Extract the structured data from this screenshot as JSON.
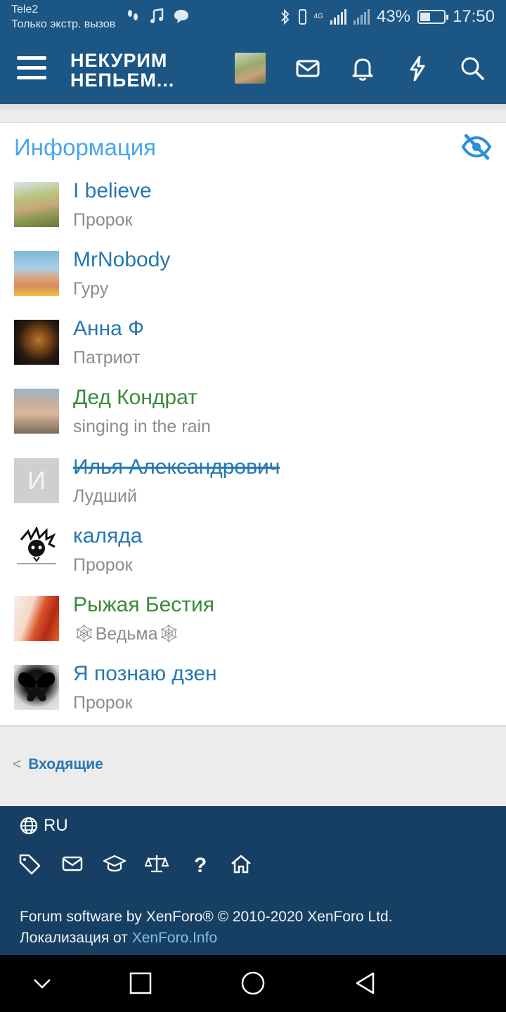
{
  "statusbar": {
    "carrier": "Tele2",
    "carrier_status": "Только экстр. вызов",
    "network": "4G",
    "battery": "43%",
    "battery_level": 0.43,
    "time": "17:50"
  },
  "header": {
    "logo_line1": "НЕКУРИМ",
    "logo_line2": "НЕПЬЕМ..."
  },
  "panel": {
    "title": "Информация",
    "members": [
      {
        "name": "I believe",
        "title": "Пророк",
        "style": "blue"
      },
      {
        "name": "MrNobody",
        "title": "Гуру",
        "style": "blue"
      },
      {
        "name": "Анна Ф",
        "title": "Патриот",
        "style": "blue"
      },
      {
        "name": "Дед Кондрат",
        "title": "singing in the rain",
        "style": "green"
      },
      {
        "name": "Илья Александрович",
        "title": "Лудший",
        "style": "strike",
        "avatar_letter": "И"
      },
      {
        "name": "каляда",
        "title": "Пророк",
        "style": "blue"
      },
      {
        "name": "Рыжая Бестия",
        "title": "🕸Ведьма🕸",
        "style": "green"
      },
      {
        "name": "Я познаю дзен",
        "title": "Пророк",
        "style": "blue"
      }
    ]
  },
  "nav": {
    "back_label": "Входящие"
  },
  "footer": {
    "language": "RU",
    "copyright": "Forum software by XenForo® © 2010-2020 XenForo Ltd.",
    "localization_prefix": "Локализация от ",
    "localization_link": "XenForo.Info"
  },
  "colors": {
    "header_bg": "#1c5684",
    "footer_bg": "#173f63",
    "link_blue": "#2577b1",
    "title_blue": "#47a7eb",
    "green_name": "#3a8a3a"
  }
}
